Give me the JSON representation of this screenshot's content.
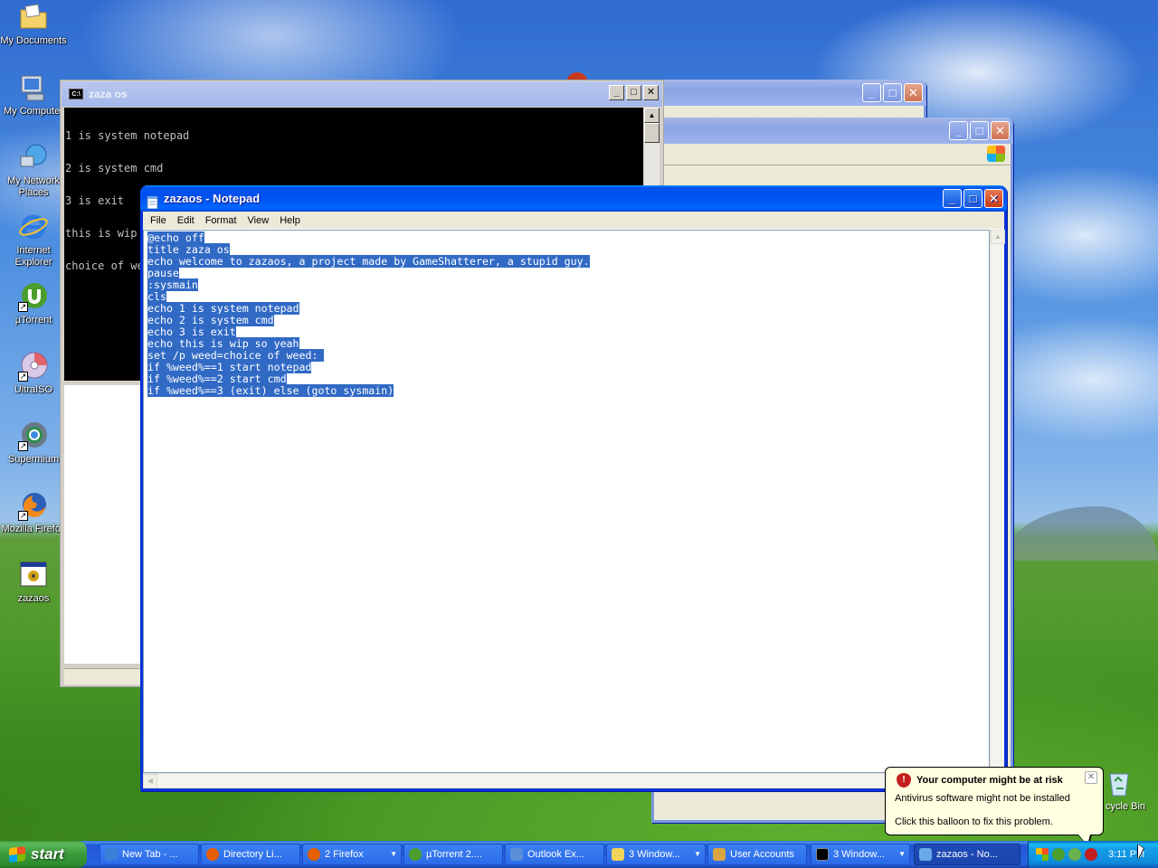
{
  "desktop_icons": [
    {
      "label": "My Documents",
      "icon": "folder-documents-icon"
    },
    {
      "label": "My Computer",
      "icon": "computer-icon"
    },
    {
      "label": "My Network Places",
      "icon": "network-icon"
    },
    {
      "label": "Internet Explorer",
      "icon": "internet-explorer-icon"
    },
    {
      "label": "µTorrent",
      "icon": "utorrent-icon"
    },
    {
      "label": "UltraISO",
      "icon": "ultraiso-icon"
    },
    {
      "label": "Supermium",
      "icon": "supermium-icon"
    },
    {
      "label": "Mozilla Firefox",
      "icon": "firefox-icon"
    },
    {
      "label": "zazaos",
      "icon": "batch-file-icon"
    }
  ],
  "console": {
    "title": "zaza os",
    "icon_text": "C:\\",
    "lines": [
      "1 is system notepad",
      "2 is system cmd",
      "3 is exit",
      "this is wip so yeah",
      "choice of weed:"
    ]
  },
  "notepad": {
    "title": "zazaos - Notepad",
    "menu": [
      "File",
      "Edit",
      "Format",
      "View",
      "Help"
    ],
    "lines": [
      "@echo off",
      "title zaza os",
      "echo welcome to zazaos, a project made by GameShatterer, a stupid guy.",
      "pause",
      ":sysmain",
      "cls",
      "echo 1 is system notepad",
      "echo 2 is system cmd",
      "echo 3 is exit",
      "echo this is wip so yeah",
      "set /p weed=choice of weed: ",
      "if %weed%==1 start notepad",
      "if %weed%==2 start cmd",
      "if %weed%==3 (exit) else (goto sysmain)"
    ],
    "selection_color": "#316ac5"
  },
  "balloon": {
    "title": "Your computer might be at risk",
    "line1": "Antivirus software might not be installed",
    "line2": "Click this balloon to fix this problem."
  },
  "recycle_bin": {
    "label": "cycle Bin"
  },
  "taskbar": {
    "start_label": "start",
    "items": [
      {
        "label": "New Tab - ...",
        "icon": "supermium-icon",
        "color": "#3a7fd8",
        "dropdown": false
      },
      {
        "label": "Directory Li...",
        "icon": "firefox-icon",
        "color": "#e66000",
        "dropdown": false
      },
      {
        "label": "2 Firefox",
        "icon": "firefox-icon",
        "color": "#e66000",
        "dropdown": true
      },
      {
        "label": "µTorrent 2....",
        "icon": "utorrent-icon",
        "color": "#4b9e2b",
        "dropdown": false
      },
      {
        "label": "Outlook Ex...",
        "icon": "outlook-express-icon",
        "color": "#5a8fd8",
        "dropdown": false
      },
      {
        "label": "3 Window...",
        "icon": "folder-icon",
        "color": "#f2d35b",
        "dropdown": true
      },
      {
        "label": "User Accounts",
        "icon": "user-accounts-icon",
        "color": "#d9a441",
        "dropdown": false
      },
      {
        "label": "3 Window...",
        "icon": "console-icon",
        "color": "#000000",
        "dropdown": true
      },
      {
        "label": "zazaos - No...",
        "icon": "notepad-icon",
        "color": "#6aa9e8",
        "dropdown": false
      }
    ],
    "clock": "3:11 PM"
  }
}
